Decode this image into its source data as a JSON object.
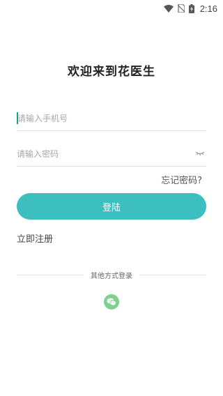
{
  "status_bar": {
    "time": "2:16",
    "icons": [
      "wifi-icon",
      "no-sim-icon",
      "battery-charging-icon"
    ]
  },
  "title": "欢迎来到花医生",
  "phone_field": {
    "value": "",
    "placeholder": "请输入手机号"
  },
  "password_field": {
    "value": "",
    "placeholder": "请输入密码",
    "toggle_icon": "eye-closed-icon"
  },
  "forgot_password": "忘记密码?",
  "login_button": "登陆",
  "register_link": "立即注册",
  "other_login": {
    "label": "其他方式登录",
    "options": [
      "wechat-icon"
    ]
  },
  "colors": {
    "accent": "#3dbfbf",
    "caret": "#1e9e86",
    "wechat": "#7ed08f"
  }
}
